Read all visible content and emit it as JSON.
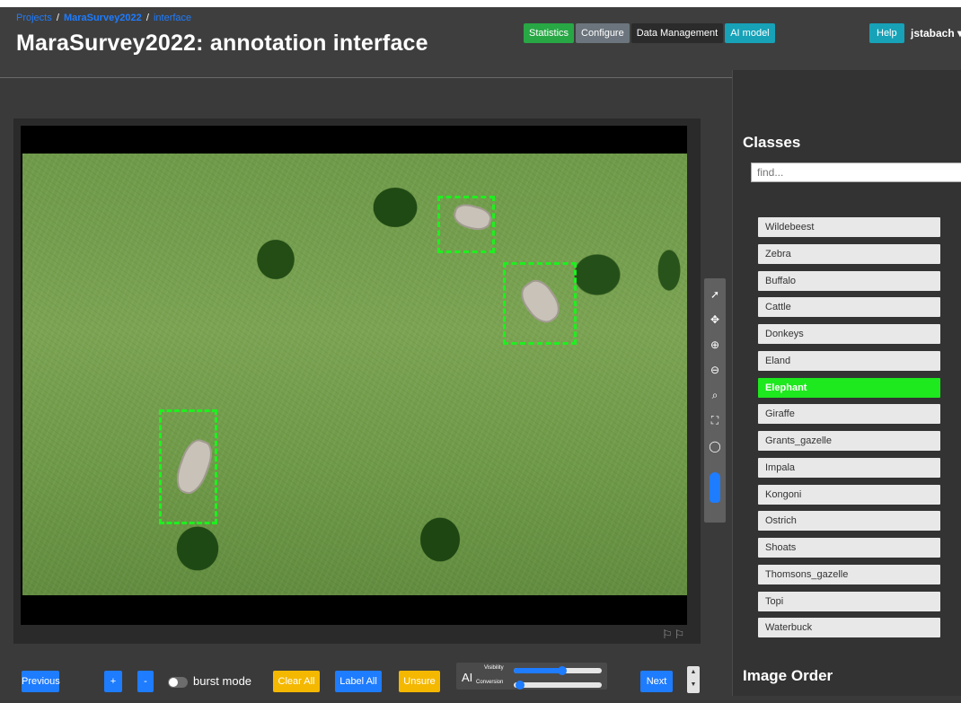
{
  "breadcrumb": {
    "projects": "Projects",
    "sep": "/",
    "project": "MaraSurvey2022",
    "current": "interface"
  },
  "page_title": "MaraSurvey2022: annotation interface",
  "nav": {
    "statistics": "Statistics",
    "configure": "Configure",
    "data_management": "Data Management",
    "ai_model": "AI model",
    "help": "Help",
    "user": "jstabach ▾"
  },
  "classes": {
    "heading": "Classes",
    "find_placeholder": "find...",
    "items": [
      "Wildebeest",
      "Zebra",
      "Buffalo",
      "Cattle",
      "Donkeys",
      "Eland",
      "Elephant",
      "Giraffe",
      "Grants_gazelle",
      "Impala",
      "Kongoni",
      "Ostrich",
      "Shoats",
      "Thomsons_gazelle",
      "Topi",
      "Waterbuck"
    ],
    "selected": "Elephant",
    "selected_color": "#1ee81e"
  },
  "image_order_heading": "Image Order",
  "toolbar": {
    "previous": "Previous",
    "plus": "+",
    "minus": "-",
    "burst_mode": "burst mode",
    "clear_all": "Clear All",
    "label_all": "Label All",
    "unsure": "Unsure",
    "ai": "AI",
    "visibility": "Visibility",
    "conversion": "Conversion",
    "next": "Next"
  },
  "sliders": {
    "visibility": 0.55,
    "conversion": 0.02
  },
  "tools": [
    "select-arrow-icon",
    "pan-icon",
    "zoom-in-icon",
    "zoom-out-icon",
    "zoom-area-icon",
    "reset-zoom-icon",
    "lasso-icon",
    "paint-brush-icon"
  ],
  "image_flags": "⚐⚐",
  "colors": {
    "primary": "#1e7cff",
    "success": "#28a745",
    "warning": "#f5b800",
    "info": "#17a2b8",
    "annotation": "#1ef01e"
  }
}
